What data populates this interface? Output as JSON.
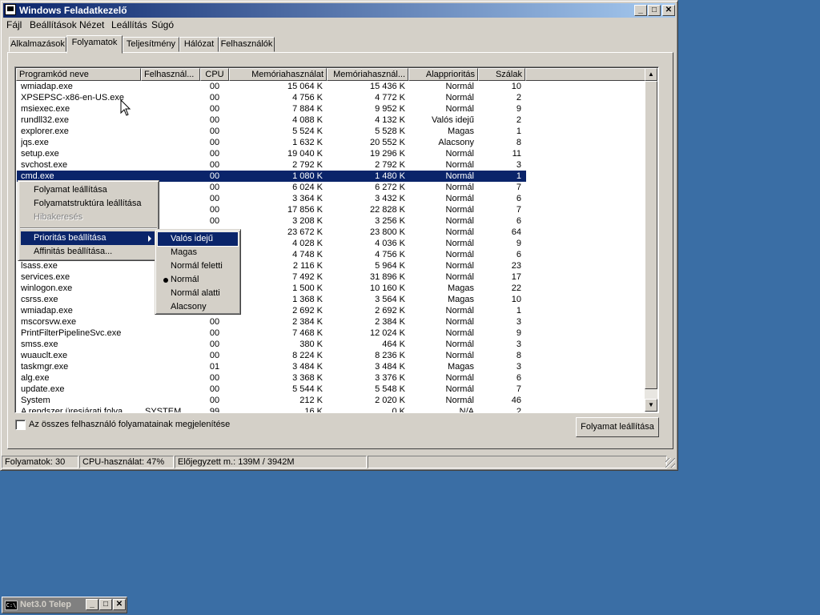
{
  "window": {
    "title": "Windows Feladatkezelő",
    "buttons": {
      "minimize": "_",
      "maximize": "□",
      "close": "✕"
    }
  },
  "menubar": [
    "Fájl",
    "Beállítások",
    "Nézet",
    "Leállítás",
    "Súgó"
  ],
  "tabs": [
    "Alkalmazások",
    "Folyamatok",
    "Teljesítmény",
    "Hálózat",
    "Felhasználók"
  ],
  "columns": [
    "Programkód neve",
    "Felhasznál...",
    "CPU",
    "Memóriahasználat",
    "Memóriahasznál...",
    "Alapprioritás",
    "Szálak"
  ],
  "rows": [
    {
      "name": "wmiadap.exe",
      "user": "",
      "cpu": "00",
      "mem": "15 064 K",
      "peak": "15 436 K",
      "prio": "Normál",
      "threads": "10"
    },
    {
      "name": "XPSEPSC-x86-en-US.exe",
      "user": "",
      "cpu": "00",
      "mem": "4 756 K",
      "peak": "4 772 K",
      "prio": "Normál",
      "threads": "2"
    },
    {
      "name": "msiexec.exe",
      "user": "",
      "cpu": "00",
      "mem": "7 884 K",
      "peak": "9 952 K",
      "prio": "Normál",
      "threads": "9"
    },
    {
      "name": "rundll32.exe",
      "user": "",
      "cpu": "00",
      "mem": "4 088 K",
      "peak": "4 132 K",
      "prio": "Valós idejű",
      "threads": "2"
    },
    {
      "name": "explorer.exe",
      "user": "",
      "cpu": "00",
      "mem": "5 524 K",
      "peak": "5 528 K",
      "prio": "Magas",
      "threads": "1"
    },
    {
      "name": "jqs.exe",
      "user": "",
      "cpu": "00",
      "mem": "1 632 K",
      "peak": "20 552 K",
      "prio": "Alacsony",
      "threads": "8"
    },
    {
      "name": "setup.exe",
      "user": "",
      "cpu": "00",
      "mem": "19 040 K",
      "peak": "19 296 K",
      "prio": "Normál",
      "threads": "11"
    },
    {
      "name": "svchost.exe",
      "user": "",
      "cpu": "00",
      "mem": "2 792 K",
      "peak": "2 792 K",
      "prio": "Normál",
      "threads": "3"
    },
    {
      "name": "cmd.exe",
      "user": "",
      "cpu": "00",
      "mem": "1 080 K",
      "peak": "1 480 K",
      "prio": "Normál",
      "threads": "1",
      "selected": true
    },
    {
      "name": "",
      "user": "",
      "cpu": "00",
      "mem": "6 024 K",
      "peak": "6 272 K",
      "prio": "Normál",
      "threads": "7"
    },
    {
      "name": "",
      "user": "",
      "cpu": "00",
      "mem": "3 364 K",
      "peak": "3 432 K",
      "prio": "Normál",
      "threads": "6"
    },
    {
      "name": "",
      "user": "",
      "cpu": "00",
      "mem": "17 856 K",
      "peak": "22 828 K",
      "prio": "Normál",
      "threads": "7"
    },
    {
      "name": "",
      "user": "",
      "cpu": "00",
      "mem": "3 208 K",
      "peak": "3 256 K",
      "prio": "Normál",
      "threads": "6"
    },
    {
      "name": "",
      "user": "",
      "cpu": "",
      "mem": "23 672 K",
      "peak": "23 800 K",
      "prio": "Normál",
      "threads": "64"
    },
    {
      "name": "",
      "user": "",
      "cpu": "",
      "mem": "4 028 K",
      "peak": "4 036 K",
      "prio": "Normál",
      "threads": "9"
    },
    {
      "name": "",
      "user": "",
      "cpu": "",
      "mem": "4 748 K",
      "peak": "4 756 K",
      "prio": "Normál",
      "threads": "6"
    },
    {
      "name": "lsass.exe",
      "user": "",
      "cpu": "",
      "mem": "2 116 K",
      "peak": "5 964 K",
      "prio": "Normál",
      "threads": "23"
    },
    {
      "name": "services.exe",
      "user": "",
      "cpu": "",
      "mem": "7 492 K",
      "peak": "31 896 K",
      "prio": "Normál",
      "threads": "17"
    },
    {
      "name": "winlogon.exe",
      "user": "",
      "cpu": "",
      "mem": "1 500 K",
      "peak": "10 160 K",
      "prio": "Magas",
      "threads": "22"
    },
    {
      "name": "csrss.exe",
      "user": "",
      "cpu": "",
      "mem": "1 368 K",
      "peak": "3 564 K",
      "prio": "Magas",
      "threads": "10"
    },
    {
      "name": "wmiadap.exe",
      "user": "",
      "cpu": "",
      "mem": "2 692 K",
      "peak": "2 692 K",
      "prio": "Normál",
      "threads": "1"
    },
    {
      "name": "mscorsvw.exe",
      "user": "",
      "cpu": "00",
      "mem": "2 384 K",
      "peak": "2 384 K",
      "prio": "Normál",
      "threads": "3"
    },
    {
      "name": "PrintFilterPipelineSvc.exe",
      "user": "",
      "cpu": "00",
      "mem": "7 468 K",
      "peak": "12 024 K",
      "prio": "Normál",
      "threads": "9"
    },
    {
      "name": "smss.exe",
      "user": "",
      "cpu": "00",
      "mem": "380 K",
      "peak": "464 K",
      "prio": "Normál",
      "threads": "3"
    },
    {
      "name": "wuauclt.exe",
      "user": "",
      "cpu": "00",
      "mem": "8 224 K",
      "peak": "8 236 K",
      "prio": "Normál",
      "threads": "8"
    },
    {
      "name": "taskmgr.exe",
      "user": "",
      "cpu": "01",
      "mem": "3 484 K",
      "peak": "3 484 K",
      "prio": "Magas",
      "threads": "3"
    },
    {
      "name": "alg.exe",
      "user": "",
      "cpu": "00",
      "mem": "3 368 K",
      "peak": "3 376 K",
      "prio": "Normál",
      "threads": "6"
    },
    {
      "name": "update.exe",
      "user": "",
      "cpu": "00",
      "mem": "5 544 K",
      "peak": "5 548 K",
      "prio": "Normál",
      "threads": "7"
    },
    {
      "name": "System",
      "user": "",
      "cpu": "00",
      "mem": "212 K",
      "peak": "2 020 K",
      "prio": "Normál",
      "threads": "46"
    },
    {
      "name": "A rendszer üresjárati folya...",
      "user": "SYSTEM",
      "cpu": "99",
      "mem": "16 K",
      "peak": "0 K",
      "prio": "N/A",
      "threads": "2"
    }
  ],
  "context_menu": {
    "items": [
      "Folyamat leállítása",
      "Folyamatstruktúra leállítása",
      "Hibakeresés",
      "Prioritás beállítása",
      "Affinitás beállítása..."
    ]
  },
  "priority_submenu": {
    "items": [
      "Valós idejű",
      "Magas",
      "Normál feletti",
      "Normál",
      "Normál alatti",
      "Alacsony"
    ],
    "checked": "Normál"
  },
  "show_all_users_label": "Az összes felhasználó folyamatainak megjelenítése",
  "end_process_button": "Folyamat leállítása",
  "statusbar": {
    "processes": "Folyamatok: 30",
    "cpu": "CPU-használat: 47%",
    "commit": "Előjegyzett m.: 139M / 3942M"
  },
  "taskbar_window": {
    "title": "Net3.0 Telep"
  },
  "colors": {
    "desktop": "#3a6ea5",
    "selection": "#0a246a",
    "face": "#d4d0c8"
  }
}
